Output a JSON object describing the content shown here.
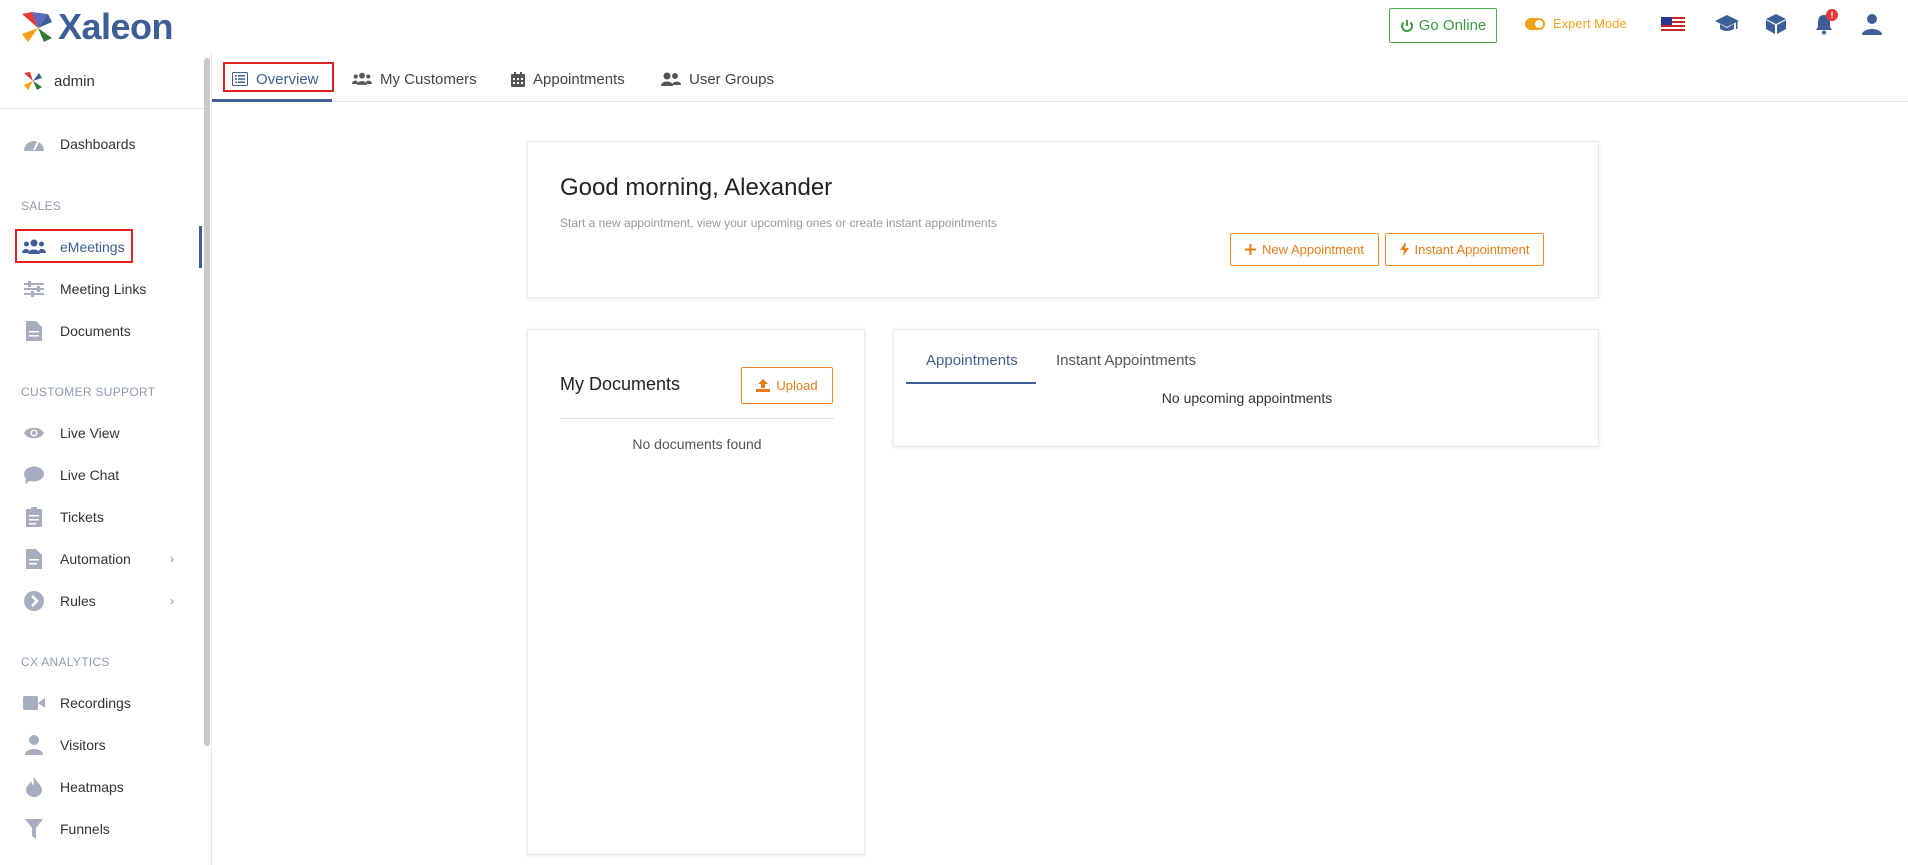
{
  "app": {
    "logo_text": "Xaleon"
  },
  "header": {
    "go_online_label": "Go Online",
    "expert_mode_label": "Expert Mode",
    "notification_count": "!",
    "accent_color": "#3e5f95",
    "orange_color": "#f08a24",
    "green_color": "#4caf50"
  },
  "sidebar": {
    "user_label": "admin",
    "dashboards": "Dashboards",
    "sections": {
      "sales": "SALES",
      "customer_support": "CUSTOMER SUPPORT",
      "cx_analytics": "CX ANALYTICS"
    },
    "items": {
      "emeetings": "eMeetings",
      "meeting_links": "Meeting Links",
      "documents": "Documents",
      "live_view": "Live View",
      "live_chat": "Live Chat",
      "tickets": "Tickets",
      "automation": "Automation",
      "rules": "Rules",
      "recordings": "Recordings",
      "visitors": "Visitors",
      "heatmaps": "Heatmaps",
      "funnels": "Funnels"
    }
  },
  "tabs": {
    "overview": "Overview",
    "my_customers": "My Customers",
    "appointments": "Appointments",
    "user_groups": "User Groups"
  },
  "greeting": {
    "title": "Good morning, Alexander",
    "subtitle": "Start a new appointment, view your upcoming ones or create instant appointments",
    "new_appointment": "New Appointment",
    "instant_appointment": "Instant Appointment"
  },
  "documents_card": {
    "title": "My Documents",
    "upload_label": "Upload",
    "empty_text": "No documents found"
  },
  "appointments_card": {
    "tab_appointments": "Appointments",
    "tab_instant": "Instant Appointments",
    "empty_text": "No upcoming appointments"
  }
}
